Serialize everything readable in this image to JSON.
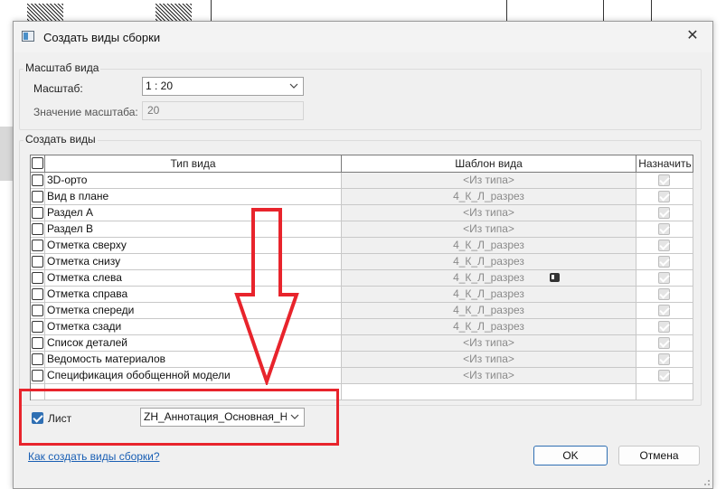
{
  "dialog": {
    "title": "Создать виды сборки",
    "close_glyph": "✕"
  },
  "scale_group": {
    "label": "Масштаб вида",
    "scale_label": "Масштаб:",
    "scale_value": "1 : 20",
    "scale_value_label": "Значение масштаба:",
    "scale_value_field": "20"
  },
  "views_group": {
    "label": "Создать виды",
    "columns": [
      "Тип вида",
      "Шаблон вида",
      "Назначить"
    ],
    "rows": [
      {
        "name": "3D-орто",
        "template": "<Из типа>"
      },
      {
        "name": "Вид в плане",
        "template": "4_К_Л_разрез"
      },
      {
        "name": "Раздел A",
        "template": "<Из типа>"
      },
      {
        "name": "Раздел B",
        "template": "<Из типа>"
      },
      {
        "name": "Отметка сверху",
        "template": "4_К_Л_разрез"
      },
      {
        "name": "Отметка снизу",
        "template": "4_К_Л_разрез"
      },
      {
        "name": "Отметка слева",
        "template": "4_К_Л_разрез"
      },
      {
        "name": "Отметка справа",
        "template": "4_К_Л_разрез"
      },
      {
        "name": "Отметка спереди",
        "template": "4_К_Л_разрез"
      },
      {
        "name": "Отметка сзади",
        "template": "4_К_Л_разрез"
      },
      {
        "name": "Список деталей",
        "template": "<Из типа>"
      },
      {
        "name": "Ведомость материалов",
        "template": "<Из типа>"
      },
      {
        "name": "Спецификация обобщенной модели",
        "template": "<Из типа>"
      }
    ]
  },
  "sheet": {
    "label": "Лист",
    "value": "ZH_Аннотация_Основная_Надпись"
  },
  "footer": {
    "help_link": "Как создать виды сборки?",
    "ok_label": "OK",
    "cancel_label": "Отмена"
  },
  "colors": {
    "annotation_red": "#e8242c",
    "accent_blue": "#2f6fb3"
  },
  "icons": [
    "app-window-icon",
    "close-icon",
    "chevron-down-icon",
    "red-arrow-annotation",
    "template-link-icon"
  ]
}
